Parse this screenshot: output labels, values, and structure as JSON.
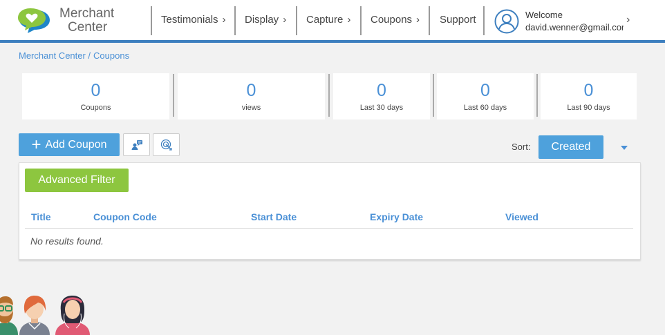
{
  "header": {
    "logo_line1": "Merchant",
    "logo_line2": "Center",
    "nav": [
      {
        "label": "Testimonials"
      },
      {
        "label": "Display"
      },
      {
        "label": "Capture"
      },
      {
        "label": "Coupons"
      },
      {
        "label": "Support"
      }
    ],
    "welcome": "Welcome",
    "email": "david.wenner@gmail.com"
  },
  "breadcrumb": {
    "home": "Merchant Center /",
    "current": "Coupons"
  },
  "stats": [
    {
      "value": "0",
      "label": "Coupons"
    },
    {
      "value": "0",
      "label": "views"
    },
    {
      "value": "0",
      "label": "Last 30 days"
    },
    {
      "value": "0",
      "label": "Last 60 days"
    },
    {
      "value": "0",
      "label": "Last 90 days"
    }
  ],
  "toolbar": {
    "add_label": "Add Coupon",
    "sort_label": "Sort:",
    "sort_value": "Created"
  },
  "panel": {
    "filter_label": "Advanced Filter",
    "columns": [
      "Title",
      "Coupon Code",
      "Start Date",
      "Expiry Date",
      "Viewed"
    ],
    "empty_text": "No results found."
  },
  "colors": {
    "accent": "#4a90d6",
    "header_border": "#3d7fbf",
    "filter_green": "#8dc63f",
    "button_blue": "#4ea1dc"
  }
}
